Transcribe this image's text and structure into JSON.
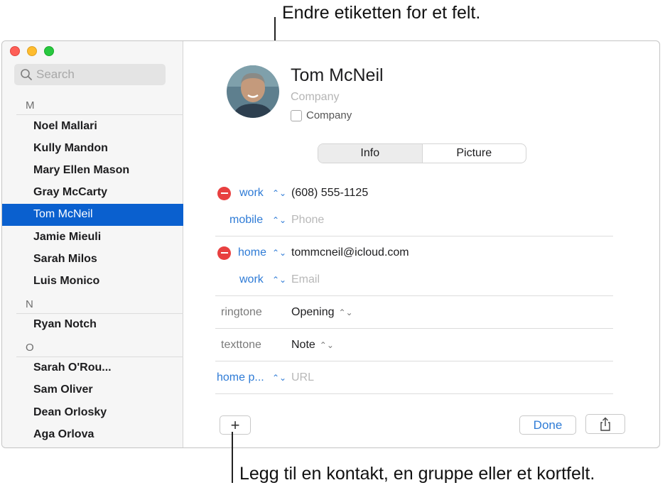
{
  "callouts": {
    "top": "Endre etiketten for et felt.",
    "bottom": "Legg til en kontakt, en gruppe eller et kortfelt."
  },
  "window": {
    "search_placeholder": "Search",
    "sections": [
      {
        "letter": "M",
        "contacts": [
          "Noel Mallari",
          "Kully Mandon",
          "Mary Ellen Mason",
          "Gray McCarty",
          "Tom McNeil",
          "Jamie Mieuli",
          "Sarah Milos",
          "Luis Monico"
        ]
      },
      {
        "letter": "N",
        "contacts": [
          "Ryan Notch"
        ]
      },
      {
        "letter": "O",
        "contacts": [
          "Sarah O'Rou...",
          "Sam Oliver",
          "Dean Orlosky",
          "Aga Orlova"
        ]
      }
    ],
    "selected_contact": "Tom McNeil"
  },
  "card": {
    "name": "Tom McNeil",
    "company_placeholder": "Company",
    "company_checkbox_label": "Company",
    "tabs": [
      "Info",
      "Picture"
    ],
    "active_tab": "Info",
    "fields": [
      {
        "label": "work",
        "value": "(608) 555-1125",
        "placeholder": false,
        "removable": true,
        "label_style": "blue"
      },
      {
        "label": "mobile",
        "value": "Phone",
        "placeholder": true,
        "removable": false,
        "label_style": "blue"
      },
      {
        "label": "home",
        "value": "tommcneil@icloud.com",
        "placeholder": false,
        "removable": true,
        "label_style": "blue"
      },
      {
        "label": "work",
        "value": "Email",
        "placeholder": true,
        "removable": false,
        "label_style": "blue"
      },
      {
        "label": "ringtone",
        "value": "Opening",
        "placeholder": false,
        "removable": false,
        "label_style": "gray"
      },
      {
        "label": "texttone",
        "value": "Note",
        "placeholder": false,
        "removable": false,
        "label_style": "gray"
      },
      {
        "label": "home p...",
        "value": "URL",
        "placeholder": true,
        "removable": false,
        "label_style": "blue"
      }
    ],
    "add_button": "+",
    "done_button": "Done"
  },
  "colors": {
    "selection": "#0a60cf",
    "accent": "#2e7bd6",
    "remove": "#e84040"
  },
  "icons": [
    "search-icon",
    "share-icon",
    "remove-icon",
    "stepper-icon",
    "plus-icon"
  ]
}
